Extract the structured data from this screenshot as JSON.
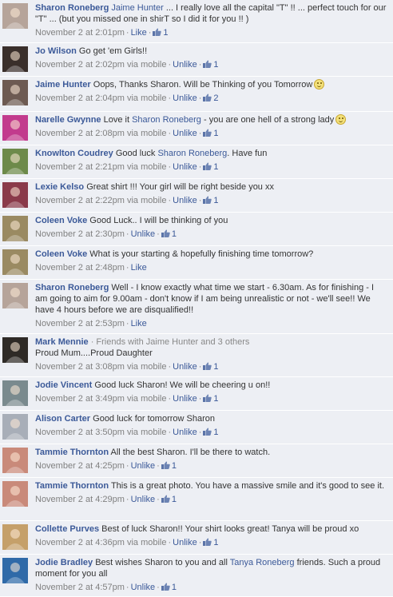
{
  "comments": [
    {
      "author": "Sharon Roneberg",
      "mention": "Jaime Hunter",
      "text": " ... I really love all the capital \"T\" !! ... perfect touch for our \"T\" ... (but you missed one in shirT so I did it for you !! )",
      "time": "November 2 at 2:01pm",
      "action": "Like",
      "likes": "1",
      "avatar_color": "#b6a49a"
    },
    {
      "author": "Jo Wilson",
      "text": "Go get 'em Girls!!",
      "time": "November 2 at 2:02pm via mobile",
      "action": "Unlike",
      "likes": "1",
      "avatar_color": "#3a2f2b"
    },
    {
      "author": "Jaime Hunter",
      "text": "Oops, Thanks Sharon. Will be Thinking of you Tomorrow",
      "emoji": "smiley",
      "time": "November 2 at 2:04pm via mobile",
      "action": "Unlike",
      "likes": "2",
      "avatar_color": "#6d5a52"
    },
    {
      "author": "Narelle Gwynne",
      "text": "Love it ",
      "mention": "Sharon Roneberg",
      "text_after": " - you are one hell of a strong lady",
      "emoji": "smiley",
      "time": "November 2 at 2:08pm via mobile",
      "action": "Unlike",
      "likes": "1",
      "avatar_color": "#c23b8d"
    },
    {
      "author": "Knowlton Coudrey",
      "text": "Good luck ",
      "mention": "Sharon Roneberg",
      "text_after": ". Have fun",
      "time": "November 2 at 2:21pm via mobile",
      "action": "Unlike",
      "likes": "1",
      "avatar_color": "#6d8a4a"
    },
    {
      "author": "Lexie Kelso",
      "text": "Great shirt !!! Your girl will be right beside you xx",
      "time": "November 2 at 2:22pm via mobile",
      "action": "Unlike",
      "likes": "1",
      "avatar_color": "#8a3a4a"
    },
    {
      "author": "Coleen Voke",
      "text": "Good Luck.. I will be thinking of you",
      "time": "November 2 at 2:30pm",
      "action": "Unlike",
      "likes": "1",
      "avatar_color": "#9a8a62"
    },
    {
      "author": "Coleen Voke",
      "text": "What is your starting & hopefully finishing time tomorrow?",
      "time": "November 2 at 2:48pm",
      "action": "Like",
      "likes": "",
      "avatar_color": "#9a8a62"
    },
    {
      "author": "Sharon Roneberg",
      "text": "Well - I know exactly what time we start - 6.30am. As for finishing - I am going to aim for 9.00am - don't know if I am being unrealistic or not - we'll see!! We have 4 hours before we are disqualified!!",
      "time": "November 2 at 2:53pm",
      "action": "Like",
      "likes": "",
      "avatar_color": "#b6a49a"
    },
    {
      "author": "Mark Mennie",
      "note": " · Friends with Jaime Hunter and 3 others",
      "text_line2": "Proud Mum....Proud Daughter",
      "time": "November 2 at 3:08pm via mobile",
      "action": "Unlike",
      "likes": "1",
      "avatar_color": "#2e2a26"
    },
    {
      "author": "Jodie Vincent",
      "text": "Good luck Sharon! We will be cheering u on!!",
      "time": "November 2 at 3:49pm via mobile",
      "action": "Unlike",
      "likes": "1",
      "avatar_color": "#7a8a8e"
    },
    {
      "author": "Alison Carter",
      "text": "Good luck for tomorrow Sharon",
      "time": "November 2 at 3:50pm via mobile",
      "action": "Unlike",
      "likes": "1",
      "avatar_color": "#a8aeb8"
    },
    {
      "author": "Tammie Thornton",
      "text": "All the best Sharon. I'll be there to watch.",
      "time": "November 2 at 4:25pm",
      "action": "Unlike",
      "likes": "1",
      "avatar_color": "#c98a7a"
    },
    {
      "author": "Tammie Thornton",
      "text": "This is a great photo. You have a massive smile and it's good to see it.",
      "time": "November 2 at 4:29pm",
      "action": "Unlike",
      "likes": "1",
      "avatar_color": "#c98a7a"
    },
    {
      "author": "Collette Purves",
      "text": "Best of luck Sharon!! Your shirt looks great! Tanya will be proud xo",
      "time": "November 2 at 4:36pm via mobile",
      "action": "Unlike",
      "likes": "1",
      "avatar_color": "#c5a06a"
    },
    {
      "author": "Jodie Bradley",
      "text": "Best wishes Sharon to you and all ",
      "mention": "Tanya Roneberg",
      "text_after": " friends. Such a proud moment for you all",
      "time": "November 2 at 4:57pm",
      "action": "Unlike",
      "likes": "1",
      "avatar_color": "#2f6aa8"
    }
  ]
}
